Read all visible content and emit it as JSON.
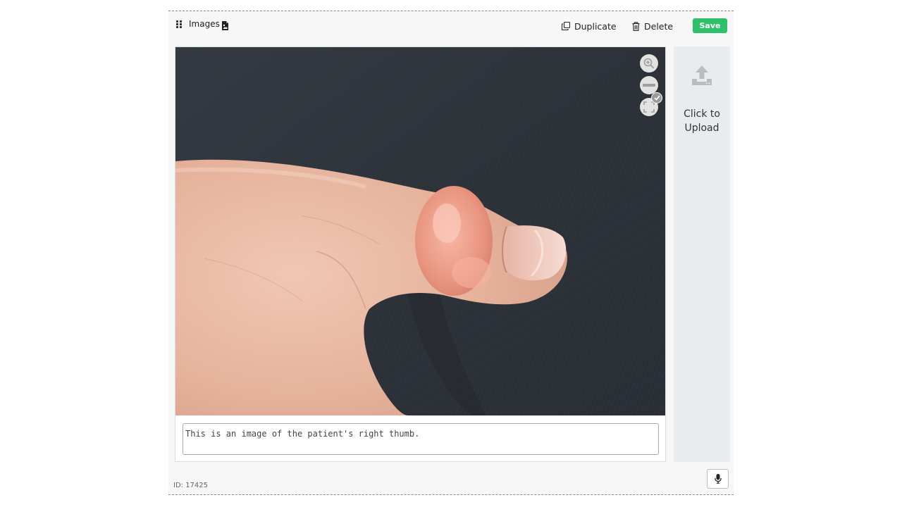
{
  "block": {
    "title": "Images",
    "title_icon": "image-file-icon",
    "id_label": "ID: 17425"
  },
  "toolbar": {
    "duplicate_label": "Duplicate",
    "delete_label": "Delete",
    "save_label": "Save"
  },
  "viewer": {
    "controls": [
      "zoom-in-icon",
      "zoom-out-icon",
      "fullscreen-icon"
    ],
    "selected_badge": "check-icon"
  },
  "caption": {
    "value": "This is an image of the patient's right thumb."
  },
  "upload": {
    "label": "Click to Upload",
    "icon": "upload-icon"
  },
  "dictation": {
    "icon": "microphone-icon"
  },
  "colors": {
    "save_button": "#2dbf6a",
    "upload_zone": "#e8ecee",
    "panel_background": "#f7f7f7"
  }
}
